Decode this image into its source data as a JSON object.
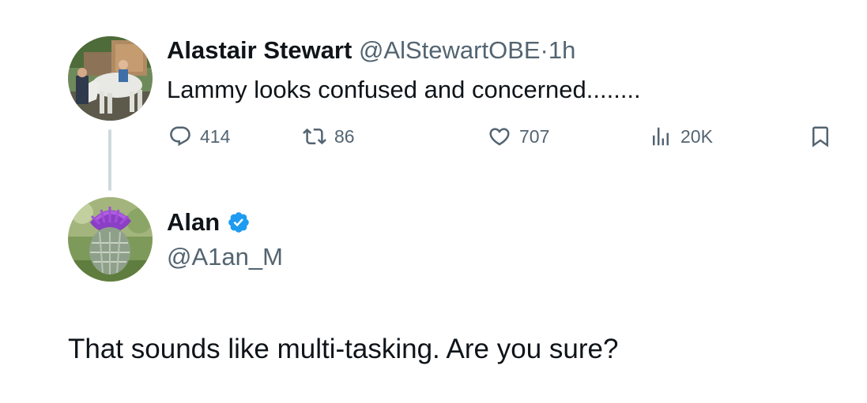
{
  "original_tweet": {
    "author_name": "Alastair Stewart",
    "handle": "@AlStewartOBE",
    "separator": "·",
    "time": "1h",
    "text": "Lammy looks confused and concerned........",
    "metrics": {
      "replies": "414",
      "retweets": "86",
      "likes": "707",
      "views": "20K"
    },
    "icons": {
      "reply": "reply-icon",
      "retweet": "retweet-icon",
      "like": "heart-icon",
      "views": "views-icon",
      "bookmark": "bookmark-icon"
    }
  },
  "reply_tweet": {
    "author_name": "Alan",
    "handle": "@A1an_M",
    "verified": true,
    "verified_color": "#1d9bf0",
    "text": "That sounds like multi-tasking. Are you sure?"
  },
  "colors": {
    "text_primary": "#0f1419",
    "text_secondary": "#536471",
    "thread_line": "#cfd9de",
    "verified_badge": "#1d9bf0"
  }
}
